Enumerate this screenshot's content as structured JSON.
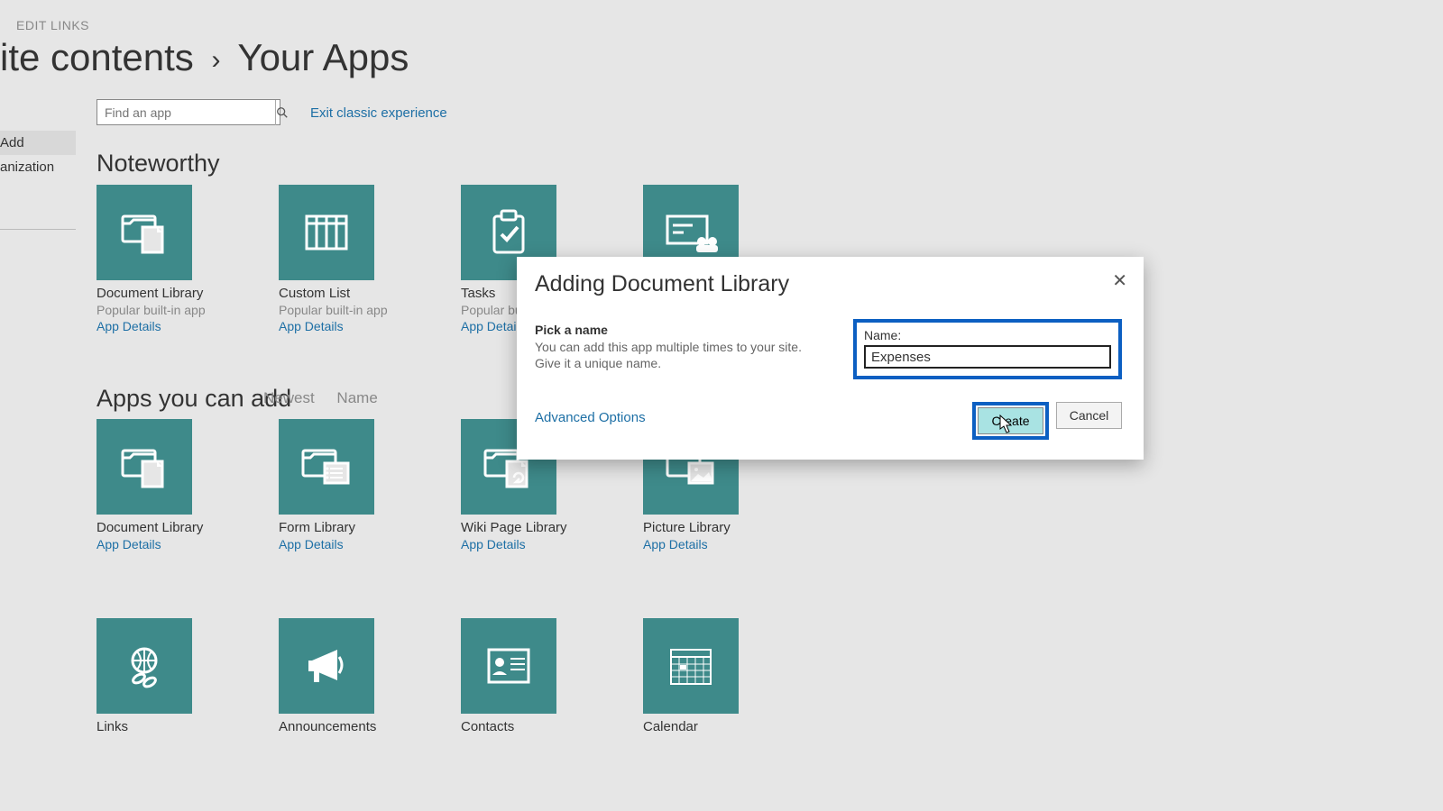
{
  "header": {
    "edit_links": "EDIT LINKS",
    "breadcrumb_part1": "ite contents",
    "breadcrumb_part2": "Your Apps"
  },
  "search": {
    "placeholder": "Find an app"
  },
  "exit_classic": "Exit classic experience",
  "sidebar": {
    "items": [
      {
        "label": "Add"
      },
      {
        "label": "anization"
      }
    ]
  },
  "sections": {
    "noteworthy": "Noteworthy",
    "addable": "Apps you can add"
  },
  "sort": {
    "newest": "Newest",
    "name": "Name"
  },
  "app_details_label": "App Details",
  "popular_label": "Popular built-in app",
  "popular_label_cut": "Popular bu",
  "noteworthy_apps": [
    {
      "title": "Document Library",
      "subtitle": "Popular built-in app",
      "icon": "document-library"
    },
    {
      "title": "Custom List",
      "subtitle": "Popular built-in app",
      "icon": "custom-list"
    },
    {
      "title": "Tasks",
      "subtitle": "Popular bu",
      "icon": "tasks"
    },
    {
      "title": "",
      "subtitle": "",
      "icon": "site-mailbox"
    }
  ],
  "addable_row1": [
    {
      "title": "Document Library",
      "icon": "document-library"
    },
    {
      "title": "Form Library",
      "icon": "form-library"
    },
    {
      "title": "Wiki Page Library",
      "icon": "wiki-page"
    },
    {
      "title": "Picture Library",
      "icon": "picture-library"
    }
  ],
  "addable_row2": [
    {
      "title": "Links",
      "icon": "links"
    },
    {
      "title": "Announcements",
      "icon": "announcements"
    },
    {
      "title": "Contacts",
      "icon": "contacts"
    },
    {
      "title": "Calendar",
      "icon": "calendar"
    }
  ],
  "modal": {
    "title": "Adding Document Library",
    "pick_name": "Pick a name",
    "desc": "You can add this app multiple times to your site. Give it a unique name.",
    "name_label": "Name:",
    "name_value": "Expenses",
    "advanced": "Advanced Options",
    "create": "Create",
    "cancel": "Cancel"
  }
}
